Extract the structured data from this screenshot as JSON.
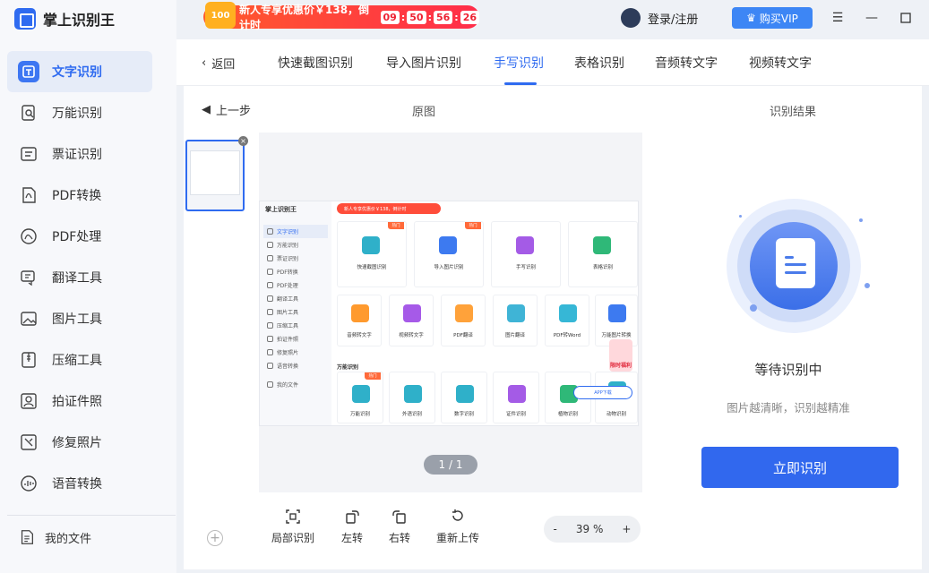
{
  "app": {
    "name": "掌上识别王"
  },
  "promo": {
    "badge": "100",
    "text": "新人专享优惠价￥138，倒计时",
    "timer": [
      "09",
      "50",
      "56",
      "26"
    ]
  },
  "header": {
    "login": "登录/注册",
    "vip": "购买VIP"
  },
  "sidebar": {
    "items": [
      {
        "label": "文字识别",
        "icon": "text-recognition-icon"
      },
      {
        "label": "万能识别",
        "icon": "universal-scan-icon"
      },
      {
        "label": "票证识别",
        "icon": "ticket-icon"
      },
      {
        "label": "PDF转换",
        "icon": "pdf-convert-icon"
      },
      {
        "label": "PDF处理",
        "icon": "pdf-process-icon"
      },
      {
        "label": "翻译工具",
        "icon": "translate-icon"
      },
      {
        "label": "图片工具",
        "icon": "image-tools-icon"
      },
      {
        "label": "压缩工具",
        "icon": "compress-icon"
      },
      {
        "label": "拍证件照",
        "icon": "id-photo-icon"
      },
      {
        "label": "修复照片",
        "icon": "repair-photo-icon"
      },
      {
        "label": "语音转换",
        "icon": "voice-convert-icon"
      }
    ],
    "my_files": "我的文件"
  },
  "tabs": {
    "back": "返回",
    "items": [
      "快速截图识别",
      "导入图片识别",
      "手写识别",
      "表格识别",
      "音频转文字",
      "视频转文字"
    ],
    "active_index": 2
  },
  "main": {
    "prev_step": "上一步",
    "original_label": "原图",
    "result_label": "识别结果",
    "page_indicator": "1 / 1",
    "toolbar": {
      "crop": "局部识别",
      "rotate_left": "左转",
      "rotate_right": "右转",
      "reupload": "重新上传"
    },
    "zoom": {
      "minus": "-",
      "value": "39 %",
      "plus": "+"
    },
    "result": {
      "status": "等待识别中",
      "hint": "图片越清晰，识别越精准",
      "button": "立即识别"
    }
  },
  "mini": {
    "logo": "掌上识别王",
    "promo": "新人专享优惠价￥138，倒计时",
    "nav": [
      "文字识别",
      "万能识别",
      "票证识别",
      "PDF转换",
      "PDF处理",
      "翻译工具",
      "图片工具",
      "压缩工具",
      "拍证件照",
      "修复照片",
      "语音转换"
    ],
    "myfiles": "我的文件",
    "cards_top": [
      "快速截图识别",
      "导入图片识别",
      "手写识别",
      "表格识别"
    ],
    "cards_mid": [
      "音频转文字",
      "视频转文字",
      "PDF翻译",
      "图片翻译",
      "PDF转Word",
      "万能图片转换"
    ],
    "section": "万能识别",
    "cards_bottom": [
      "万能识别",
      "外语识别",
      "数字识别",
      "证件识别",
      "植物识别",
      "动物识别"
    ],
    "app": "APP下载",
    "promo2": "限时福利",
    "hot": "热门"
  },
  "colors": {
    "accent": "#2f6bf0",
    "promo": "#ff3b3b"
  }
}
